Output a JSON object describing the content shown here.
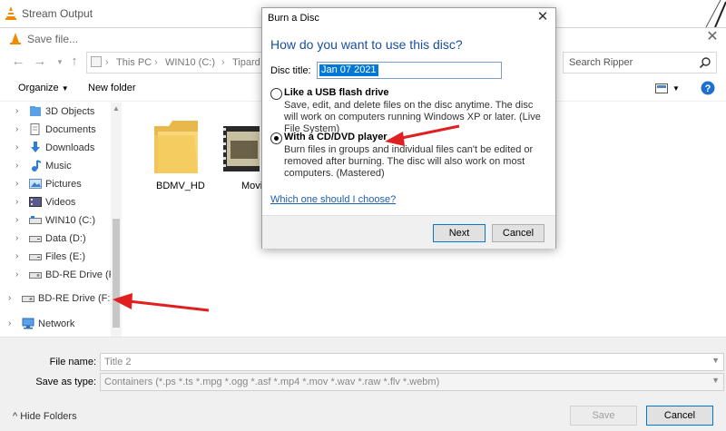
{
  "background": {
    "title": "Stream Output"
  },
  "save_dialog": {
    "title": "Save file...",
    "breadcrumb": [
      "This PC",
      "WIN10 (C:)",
      "Tipard St"
    ],
    "search_placeholder": "Search Ripper",
    "toolbar": {
      "organize": "Organize",
      "new_folder": "New folder"
    },
    "tree": [
      {
        "label": "3D Objects",
        "icon": "folder-3d-icon"
      },
      {
        "label": "Documents",
        "icon": "documents-icon"
      },
      {
        "label": "Downloads",
        "icon": "downloads-icon"
      },
      {
        "label": "Music",
        "icon": "music-icon"
      },
      {
        "label": "Pictures",
        "icon": "pictures-icon"
      },
      {
        "label": "Videos",
        "icon": "videos-icon"
      },
      {
        "label": "WIN10 (C:)",
        "icon": "drive-icon"
      },
      {
        "label": "Data (D:)",
        "icon": "drive-icon"
      },
      {
        "label": "Files (E:)",
        "icon": "drive-icon"
      },
      {
        "label": "BD-RE Drive (F:)",
        "icon": "disc-drive-icon"
      },
      {
        "label": "BD-RE Drive (F:)",
        "icon": "disc-drive-icon"
      },
      {
        "label": "Network",
        "icon": "network-icon"
      }
    ],
    "files": [
      {
        "label": "BDMV_HD",
        "icon": "folder-icon"
      },
      {
        "label": "Movi",
        "icon": "video-file-icon"
      }
    ],
    "file_name_label": "File name:",
    "file_name_value": "Title 2",
    "save_as_type_label": "Save as type:",
    "save_as_type_value": "Containers (*.ps *.ts *.mpg *.ogg *.asf *.mp4 *.mov *.wav *.raw *.flv *.webm)",
    "hide_folders": "Hide Folders",
    "save_button": "Save",
    "cancel_button": "Cancel"
  },
  "burn_dialog": {
    "title": "Burn a Disc",
    "heading": "How do you want to use this disc?",
    "disc_title_label": "Disc title:",
    "disc_title_value": "Jan 07 2021",
    "options": [
      {
        "title": "Like a USB flash drive",
        "description": "Save, edit, and delete files on the disc anytime. The disc will work on computers running Windows XP or later. (Live File System)",
        "selected": false
      },
      {
        "title": "With a CD/DVD player",
        "description": "Burn files in groups and individual files can't be edited or removed after burning. The disc will also work on most computers. (Mastered)",
        "selected": true
      }
    ],
    "help_link": "Which one should I choose?",
    "next_button": "Next",
    "cancel_button": "Cancel"
  },
  "colors": {
    "annotation_arrow": "#e02020",
    "heading_blue": "#1a4fa0",
    "accent": "#0078d7"
  }
}
